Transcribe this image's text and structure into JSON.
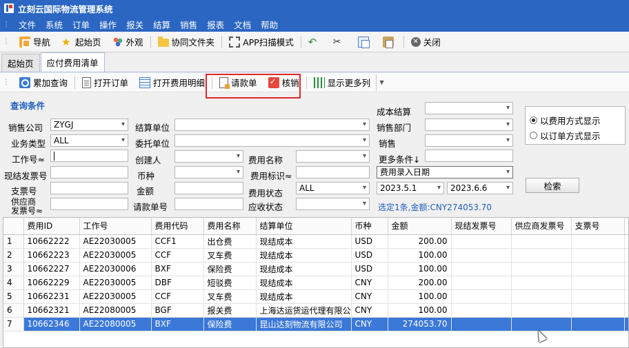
{
  "app": {
    "title": "立刻云国际物流管理系统"
  },
  "menu": [
    "文件",
    "系统",
    "订单",
    "操作",
    "报关",
    "结算",
    "销售",
    "报表",
    "文档",
    "帮助"
  ],
  "toolbar": {
    "nav": "导航",
    "home": "起始页",
    "look": "外观",
    "shared_folder": "协同文件夹",
    "app_scan": "APP扫描模式",
    "close": "关闭"
  },
  "tabs": [
    {
      "label": "起始页",
      "active": false
    },
    {
      "label": "应付费用清单",
      "active": true
    }
  ],
  "subtoolbar": {
    "add_query": "累加查询",
    "open_order": "打开订单",
    "open_fee_detail": "打开费用明细",
    "request_bill": "请款单",
    "verify": "核销",
    "show_more_cols": "显示更多列"
  },
  "query": {
    "title": "查询条件",
    "labels": {
      "sales_company": "销售公司",
      "biz_type": "业务类型",
      "job_no": "工作号≈",
      "cash_invoice_no": "现结发票号",
      "cheque_no": "支票号",
      "supplier_invoice_no_1": "供应商",
      "supplier_invoice_no_2": "发票号≈",
      "settle_unit": "结算单位",
      "entrust_unit": "委托单位",
      "creator": "创建人",
      "currency": "币种",
      "amount": "金额",
      "request_no": "请款单号",
      "fee_name": "费用名称",
      "fee_flag": "费用标识≈",
      "fee_status": "费用状态",
      "recv_status": "应收状态",
      "cost_settle": "成本结算",
      "sales_dept": "销售部门",
      "sales": "销售",
      "more_conditions": "更多条件↓"
    },
    "values": {
      "sales_company": "ZYGJ",
      "biz_type": "ALL",
      "fee_status": "ALL",
      "date_field": "费用录入日期",
      "date_from": "2023.5.1",
      "date_to": "2023.6.6"
    },
    "radios": [
      {
        "label": "以费用方式显示",
        "checked": true
      },
      {
        "label": "以订单方式显示",
        "checked": false
      }
    ],
    "search": "检索",
    "selection_info": "选定1条,金额:CNY274053.70"
  },
  "grid": {
    "columns": [
      "",
      "费用ID",
      "工作号",
      "费用代码",
      "费用名称",
      "结算单位",
      "币种",
      "金额",
      "现结发票号",
      "供应商发票号",
      "支票号",
      "专"
    ],
    "rows": [
      [
        "1",
        "10662222",
        "AE22030005",
        "CCF1",
        "出仓费",
        "现结成本",
        "USD",
        "200.00",
        "",
        "",
        "",
        ""
      ],
      [
        "2",
        "10662223",
        "AE22030005",
        "CCF",
        "叉车费",
        "现结成本",
        "USD",
        "100.00",
        "",
        "",
        "",
        ""
      ],
      [
        "3",
        "10662227",
        "AE22030006",
        "BXF",
        "保险费",
        "现结成本",
        "USD",
        "100.00",
        "",
        "",
        "",
        ""
      ],
      [
        "4",
        "10662229",
        "AE22030005",
        "DBF",
        "短驳费",
        "现结成本",
        "CNY",
        "200.00",
        "",
        "",
        "",
        ""
      ],
      [
        "5",
        "10662231",
        "AE22030005",
        "CCF",
        "叉车费",
        "现结成本",
        "CNY",
        "100.00",
        "",
        "",
        "",
        ""
      ],
      [
        "6",
        "10662321",
        "AE22080005",
        "BGF",
        "报关费",
        "上海达运货运代理有限公司",
        "CNY",
        "100.00",
        "",
        "",
        "",
        ""
      ],
      [
        "7",
        "10662346",
        "AE22080005",
        "BXF",
        "保险费",
        "昆山达刻物流有限公司",
        "CNY",
        "274053.70",
        "",
        "",
        "",
        ""
      ]
    ],
    "selected_row": 6
  }
}
